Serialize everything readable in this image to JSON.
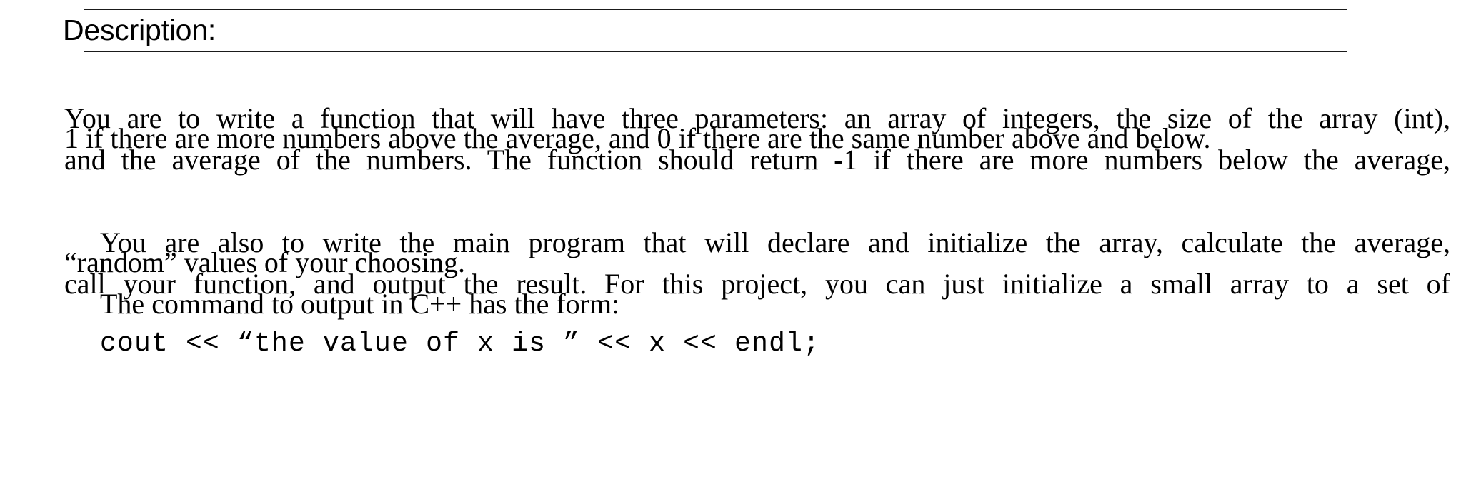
{
  "document": {
    "section_heading": "Description:",
    "paragraphs": [
      {
        "id": "p1",
        "indented": false,
        "text": "You are to write a function that will have three parameters: an array of integers, the size of the array (int), and the average of the numbers.  The function should return -1 if there are more numbers below the average, 1 if there are more numbers above the average, and 0 if there are the same number above and below.",
        "lines": [
          "You are to write a function that will have three parameters: an array of integers, the size of the array (int),",
          "and the average of the numbers.  The function should return -1 if there are more numbers below the average,",
          "1 if there are more numbers above the average, and 0 if there are the same number above and below."
        ]
      },
      {
        "id": "p2",
        "indented": true,
        "text": "You are also to write the main program that will declare and initialize the array, calculate the average, call your function, and output the result.  For this project, you can just initialize a small array to a set of “random” values of your choosing.",
        "lines": [
          "You are also to write the main program that will declare and initialize the array, calculate the average,",
          "call your function, and output the result.  For this project, you can just initialize a small array to a set of",
          "“random” values of your choosing."
        ]
      },
      {
        "id": "p3",
        "indented": true,
        "text": "The command to output in C++ has the form:",
        "lines": [
          "The command to output in C++ has the form:"
        ]
      }
    ],
    "code_sample": "cout << “the value of x is ” << x << endl;",
    "rules": {
      "above_heading": true,
      "below_heading": true,
      "color": "#1a1a1a"
    },
    "colors": {
      "page_background": "#ffffff",
      "text": "#000000"
    }
  }
}
